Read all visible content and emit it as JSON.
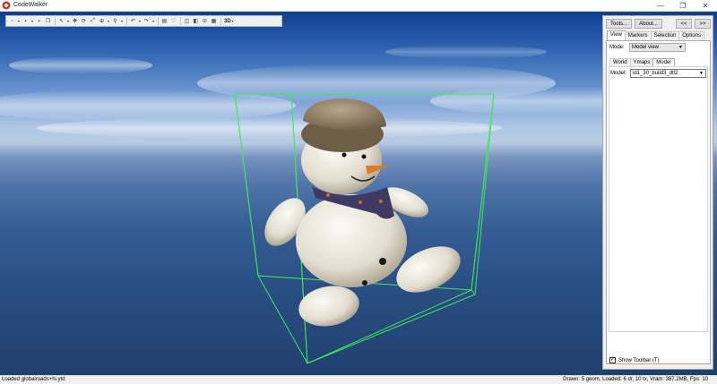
{
  "window": {
    "title": "CodeWalker",
    "minimize_glyph": "—",
    "maximize_glyph": "❐",
    "close_glyph": "✕"
  },
  "toolbar": {
    "buttons": [
      {
        "icon": "new-file-icon",
        "glyph": "▫"
      },
      {
        "icon": "save-icon",
        "glyph": "▪"
      },
      {
        "icon": "save-all-icon",
        "glyph": "▪"
      },
      {
        "icon": "copy-icon",
        "glyph": "❐"
      },
      {
        "icon": "pointer-icon",
        "glyph": "↖"
      },
      {
        "icon": "move-icon",
        "glyph": "✥"
      },
      {
        "icon": "rotate-icon",
        "glyph": "⟳"
      },
      {
        "icon": "scale-icon",
        "glyph": "⤢"
      },
      {
        "icon": "globe-icon",
        "glyph": "⊕"
      },
      {
        "icon": "snap-icon",
        "glyph": "⚲"
      },
      {
        "icon": "undo-icon",
        "glyph": "↶"
      },
      {
        "icon": "redo-icon",
        "glyph": "↷"
      },
      {
        "icon": "info-icon",
        "glyph": "▤"
      },
      {
        "icon": "heart-icon",
        "glyph": "♡"
      },
      {
        "icon": "camera-icon",
        "glyph": "◫"
      },
      {
        "icon": "screenshot-icon",
        "glyph": "◧"
      },
      {
        "icon": "link-icon",
        "glyph": "⊘"
      },
      {
        "icon": "grid-icon",
        "glyph": "▦"
      }
    ],
    "mode_3d_label": "3D"
  },
  "panel": {
    "tools_button": "Tools...",
    "about_button": "About...",
    "collapse_button": "<<",
    "expand_button": ">>",
    "tabs": [
      "View",
      "Markers",
      "Selection",
      "Options"
    ],
    "mode_label": "Mode:",
    "mode_value": "Model view",
    "subtabs": [
      "World",
      "Ymaps",
      "Model"
    ],
    "model_label": "Model:",
    "model_value": "id1_30_build3_dtl2",
    "show_toolbar_label": "Show Toolbar (T)",
    "show_toolbar_checked": true
  },
  "status": {
    "left": "Loaded globalroads+hi.ytd",
    "right": "Drawn: 5 geom, Loaded: 6 dr, 10 tx, Vram: 387.2MB, Fps: 10"
  }
}
